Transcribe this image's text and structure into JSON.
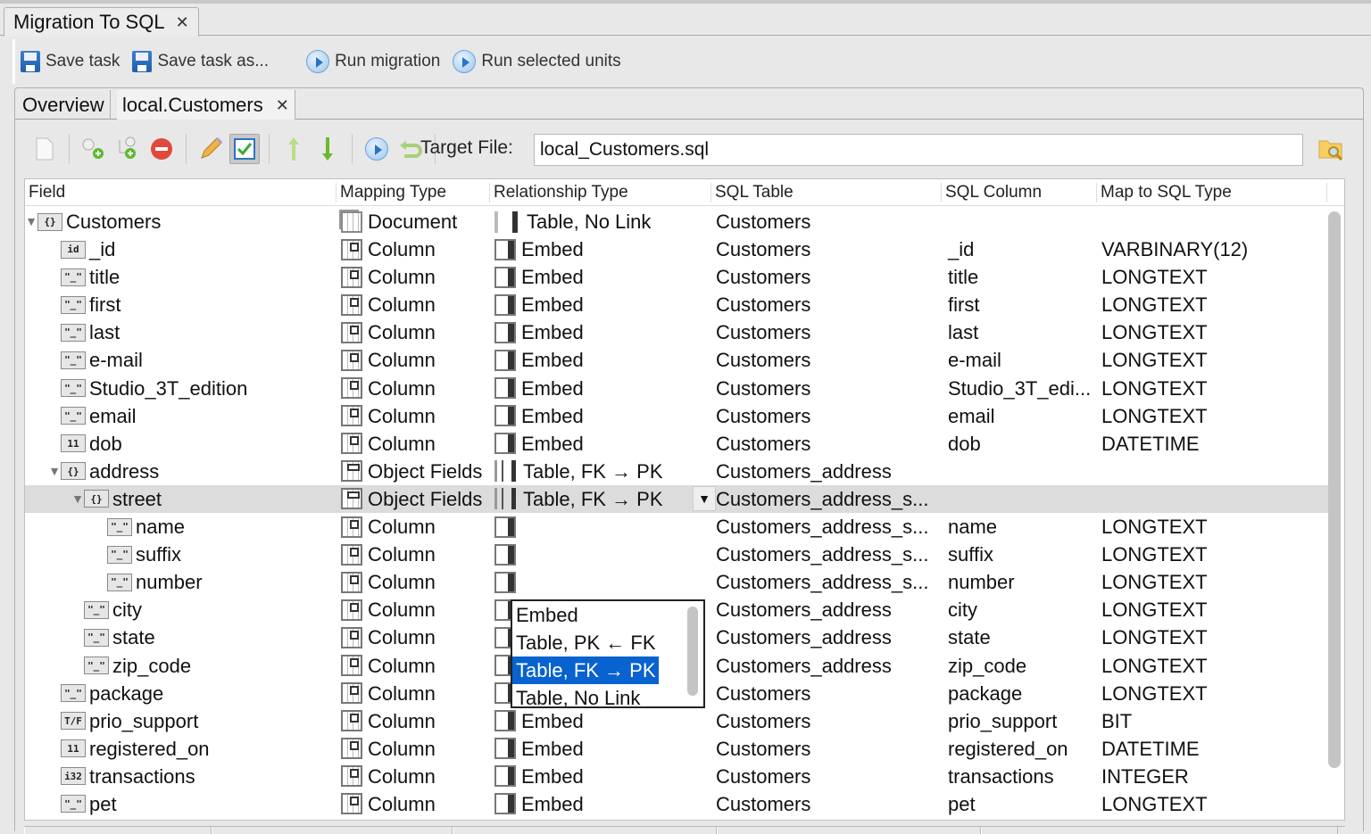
{
  "window": {
    "tab_title": "Migration To SQL"
  },
  "main_toolbar": {
    "save_task": "Save task",
    "save_task_as": "Save task as...",
    "run_migration": "Run migration",
    "run_selected_units": "Run selected units"
  },
  "sub_tabs": [
    {
      "label": "Overview",
      "active": false
    },
    {
      "label": "local.Customers",
      "active": true
    }
  ],
  "editor_toolbar": {
    "target_file_label": "Target File:",
    "target_file_value": "local_Customers.sql"
  },
  "grid": {
    "columns": [
      "Field",
      "Mapping Type",
      "Relationship Type",
      "SQL Table",
      "SQL Column",
      "Map to SQL Type"
    ],
    "rows": [
      {
        "indent": 0,
        "expander": "open",
        "ficon": "{}",
        "field": "Customers",
        "map_icon": "doc",
        "mapping": "Document",
        "rel_icon": "nolink",
        "relationship": "Table, No Link",
        "table": "Customers",
        "column": "",
        "type": ""
      },
      {
        "indent": 1,
        "expander": "",
        "ficon": "id",
        "field": "_id",
        "map_icon": "col",
        "mapping": "Column",
        "rel_icon": "embed",
        "relationship": "Embed",
        "table": "Customers",
        "column": "_id",
        "type": "VARBINARY(12)"
      },
      {
        "indent": 1,
        "expander": "",
        "ficon": "\"_\"",
        "field": "title",
        "map_icon": "col",
        "mapping": "Column",
        "rel_icon": "embed",
        "relationship": "Embed",
        "table": "Customers",
        "column": "title",
        "type": "LONGTEXT"
      },
      {
        "indent": 1,
        "expander": "",
        "ficon": "\"_\"",
        "field": "first",
        "map_icon": "col",
        "mapping": "Column",
        "rel_icon": "embed",
        "relationship": "Embed",
        "table": "Customers",
        "column": "first",
        "type": "LONGTEXT"
      },
      {
        "indent": 1,
        "expander": "",
        "ficon": "\"_\"",
        "field": "last",
        "map_icon": "col",
        "mapping": "Column",
        "rel_icon": "embed",
        "relationship": "Embed",
        "table": "Customers",
        "column": "last",
        "type": "LONGTEXT"
      },
      {
        "indent": 1,
        "expander": "",
        "ficon": "\"_\"",
        "field": "e-mail",
        "map_icon": "col",
        "mapping": "Column",
        "rel_icon": "embed",
        "relationship": "Embed",
        "table": "Customers",
        "column": "e-mail",
        "type": "LONGTEXT"
      },
      {
        "indent": 1,
        "expander": "",
        "ficon": "\"_\"",
        "field": "Studio_3T_edition",
        "map_icon": "col",
        "mapping": "Column",
        "rel_icon": "embed",
        "relationship": "Embed",
        "table": "Customers",
        "column": "Studio_3T_edi...",
        "type": "LONGTEXT"
      },
      {
        "indent": 1,
        "expander": "",
        "ficon": "\"_\"",
        "field": "email",
        "map_icon": "col",
        "mapping": "Column",
        "rel_icon": "embed",
        "relationship": "Embed",
        "table": "Customers",
        "column": "email",
        "type": "LONGTEXT"
      },
      {
        "indent": 1,
        "expander": "",
        "ficon": "11",
        "field": "dob",
        "map_icon": "col",
        "mapping": "Column",
        "rel_icon": "embed",
        "relationship": "Embed",
        "table": "Customers",
        "column": "dob",
        "type": "DATETIME"
      },
      {
        "indent": 1,
        "expander": "open",
        "ficon": "{}",
        "field": "address",
        "map_icon": "obj",
        "mapping": "Object Fields",
        "rel_icon": "link",
        "relationship": "Table, FK → PK",
        "table": "Customers_address",
        "column": "",
        "type": ""
      },
      {
        "indent": 2,
        "expander": "open",
        "ficon": "{}",
        "field": "street",
        "map_icon": "obj",
        "mapping": "Object Fields",
        "rel_icon": "link",
        "relationship": "Table, FK → PK",
        "table": "Customers_address_s...",
        "column": "",
        "type": "",
        "selected": true
      },
      {
        "indent": 3,
        "expander": "",
        "ficon": "\"_\"",
        "field": "name",
        "map_icon": "col",
        "mapping": "Column",
        "rel_icon": "embed",
        "relationship": "",
        "table": "Customers_address_s...",
        "column": "name",
        "type": "LONGTEXT"
      },
      {
        "indent": 3,
        "expander": "",
        "ficon": "\"_\"",
        "field": "suffix",
        "map_icon": "col",
        "mapping": "Column",
        "rel_icon": "embed",
        "relationship": "",
        "table": "Customers_address_s...",
        "column": "suffix",
        "type": "LONGTEXT"
      },
      {
        "indent": 3,
        "expander": "",
        "ficon": "\"_\"",
        "field": "number",
        "map_icon": "col",
        "mapping": "Column",
        "rel_icon": "embed",
        "relationship": "",
        "table": "Customers_address_s...",
        "column": "number",
        "type": "LONGTEXT"
      },
      {
        "indent": 2,
        "expander": "",
        "ficon": "\"_\"",
        "field": "city",
        "map_icon": "col",
        "mapping": "Column",
        "rel_icon": "embed",
        "relationship": "",
        "table": "Customers_address",
        "column": "city",
        "type": "LONGTEXT"
      },
      {
        "indent": 2,
        "expander": "",
        "ficon": "\"_\"",
        "field": "state",
        "map_icon": "col",
        "mapping": "Column",
        "rel_icon": "embed",
        "relationship": "Embed",
        "table": "Customers_address",
        "column": "state",
        "type": "LONGTEXT"
      },
      {
        "indent": 2,
        "expander": "",
        "ficon": "\"_\"",
        "field": "zip_code",
        "map_icon": "col",
        "mapping": "Column",
        "rel_icon": "embed",
        "relationship": "Embed",
        "table": "Customers_address",
        "column": "zip_code",
        "type": "LONGTEXT"
      },
      {
        "indent": 1,
        "expander": "",
        "ficon": "\"_\"",
        "field": "package",
        "map_icon": "col",
        "mapping": "Column",
        "rel_icon": "embed",
        "relationship": "Embed",
        "table": "Customers",
        "column": "package",
        "type": "LONGTEXT"
      },
      {
        "indent": 1,
        "expander": "",
        "ficon": "T/F",
        "field": "prio_support",
        "map_icon": "col",
        "mapping": "Column",
        "rel_icon": "embed",
        "relationship": "Embed",
        "table": "Customers",
        "column": "prio_support",
        "type": "BIT"
      },
      {
        "indent": 1,
        "expander": "",
        "ficon": "11",
        "field": "registered_on",
        "map_icon": "col",
        "mapping": "Column",
        "rel_icon": "embed",
        "relationship": "Embed",
        "table": "Customers",
        "column": "registered_on",
        "type": "DATETIME"
      },
      {
        "indent": 1,
        "expander": "",
        "ficon": "i32",
        "field": "transactions",
        "map_icon": "col",
        "mapping": "Column",
        "rel_icon": "embed",
        "relationship": "Embed",
        "table": "Customers",
        "column": "transactions",
        "type": "INTEGER"
      },
      {
        "indent": 1,
        "expander": "",
        "ficon": "\"_\"",
        "field": "pet",
        "map_icon": "col",
        "mapping": "Column",
        "rel_icon": "embed",
        "relationship": "Embed",
        "table": "Customers",
        "column": "pet",
        "type": "LONGTEXT"
      }
    ]
  },
  "relationship_dropdown": {
    "options": [
      "Embed",
      "Table, PK ← FK",
      "Table, FK → PK",
      "Table, No Link"
    ],
    "selected": "Table, FK → PK"
  },
  "colors": {
    "selection_blue": "#0862d0",
    "row_selected": "#dcdcdc"
  }
}
